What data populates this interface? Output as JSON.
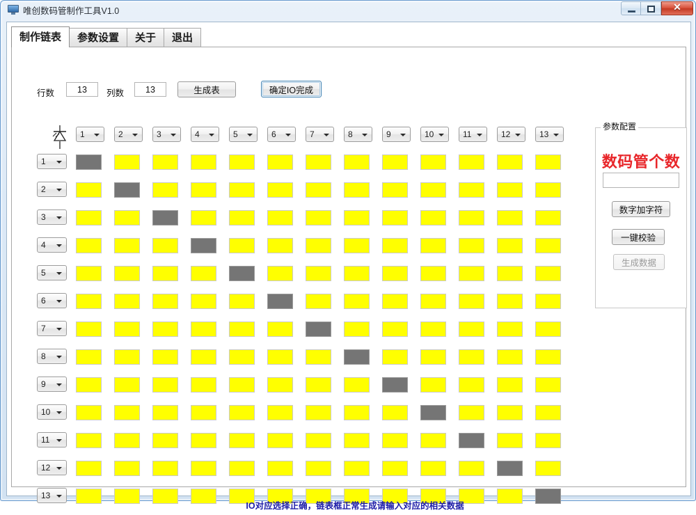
{
  "window": {
    "title": "唯创数码管制作工具V1.0",
    "icon": "monitor-icon",
    "buttons": {
      "minimize": "minimize-icon",
      "maximize": "maximize-icon",
      "close": "✕"
    }
  },
  "tabs": [
    {
      "label": "制作链表",
      "active": true
    },
    {
      "label": "参数设置",
      "active": false
    },
    {
      "label": "关于",
      "active": false
    },
    {
      "label": "退出",
      "active": false
    }
  ],
  "toolbar": {
    "rows_label": "行数",
    "rows_value": "13",
    "cols_label": "列数",
    "cols_value": "13",
    "generate_table_label": "生成表",
    "confirm_io_label": "确定IO完成",
    "corner_icon": "led-diode-icon"
  },
  "grid": {
    "col_headers": [
      "1",
      "2",
      "3",
      "4",
      "5",
      "6",
      "7",
      "8",
      "9",
      "10",
      "11",
      "12",
      "13"
    ],
    "row_headers": [
      "1",
      "2",
      "3",
      "4",
      "5",
      "6",
      "7",
      "8",
      "9",
      "10",
      "11",
      "12",
      "13"
    ],
    "cell_colors": {
      "normal": "#ffff00",
      "selected": "#757575"
    },
    "selected_pattern": "diagonal",
    "rows": 13,
    "cols": 13
  },
  "panel": {
    "group_title": "参数配置",
    "heading": "数码管个数",
    "heading_color": "#e8262a",
    "count_value": "",
    "count_placeholder": "",
    "buttons": [
      {
        "label": "数字加字符",
        "disabled": false
      },
      {
        "label": "一键校验",
        "disabled": false
      },
      {
        "label": "生成数据",
        "disabled": true
      }
    ]
  },
  "status": {
    "message": "IO对应选择正确，链表框正常生成请输入对应的相关数据",
    "color": "#1c1ca8"
  }
}
